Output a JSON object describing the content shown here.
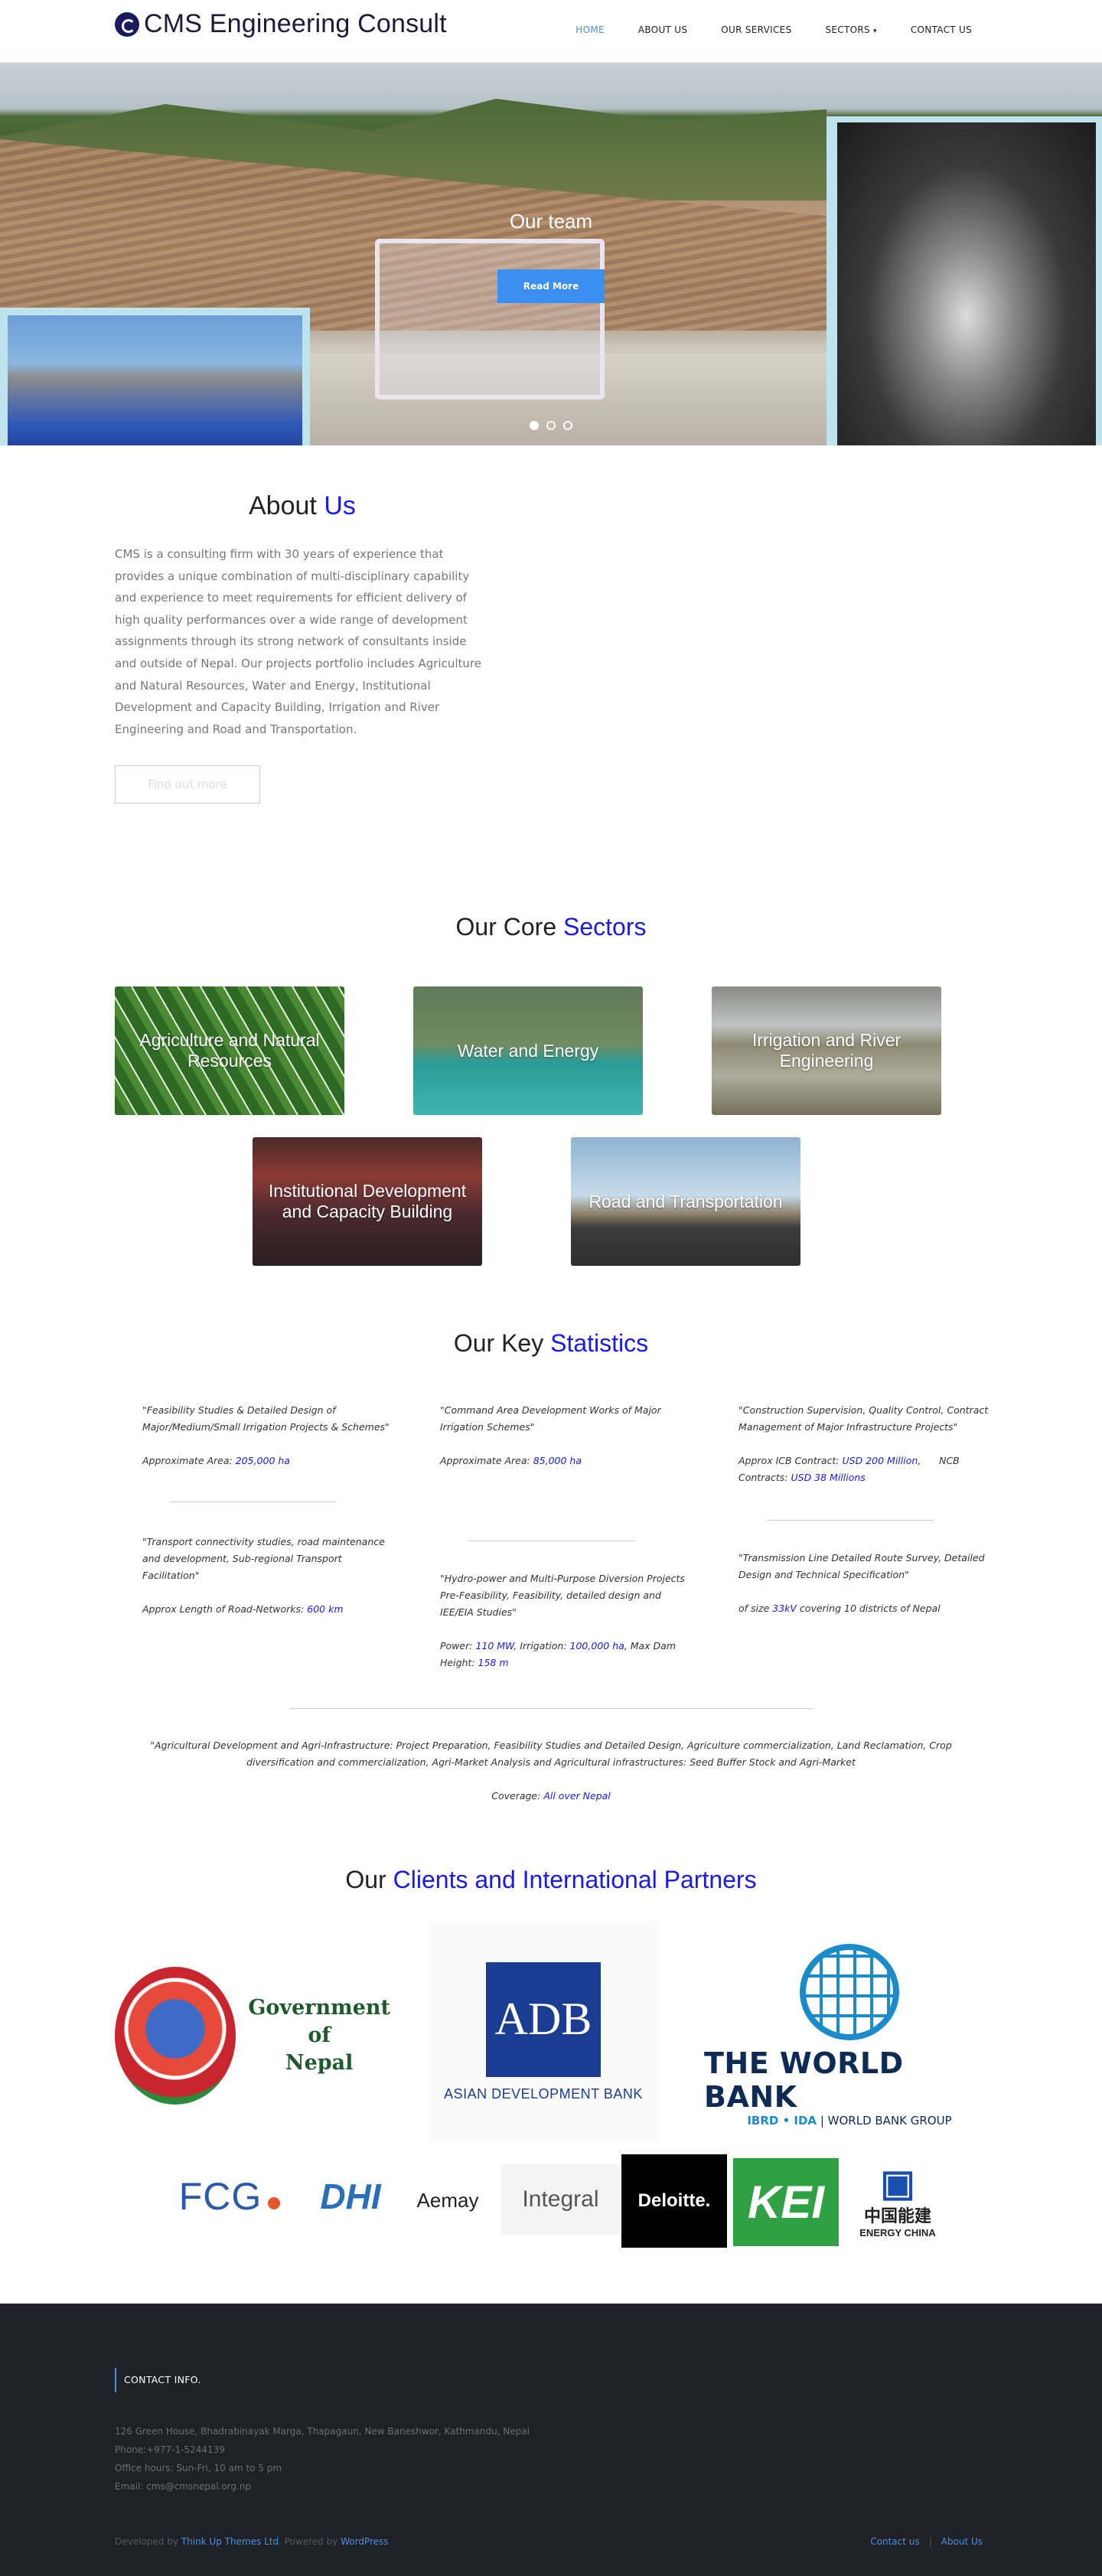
{
  "header": {
    "logo_text": "CMS Engineering Consult",
    "nav": [
      {
        "label": "HOME",
        "active": true
      },
      {
        "label": "ABOUT US"
      },
      {
        "label": "OUR SERVICES"
      },
      {
        "label": "SECTORS"
      },
      {
        "label": "CONTACT US"
      }
    ],
    "dropdown_caret": "▾"
  },
  "hero": {
    "caption": "Our team",
    "button_label": "Read More",
    "slides": 3,
    "active_slide": 1
  },
  "about": {
    "title_a": "About",
    "title_b": "Us",
    "body": "CMS is a consulting firm with 30 years of experience that provides a unique combination of multi-disciplinary capability and experience to meet requirements for efficient delivery of high quality performances over a wide range of development assignments through its strong network of consultants inside and outside of Nepal. Our projects portfolio includes Agriculture and Natural Resources, Water and Energy, Institutional Development and Capacity Building, Irrigation and River Engineering and Road and Transportation.",
    "button_label": "Find out more"
  },
  "sectors": {
    "title_a": "Our Core",
    "title_b": "Sectors",
    "items": [
      "Agriculture and Natural Resources",
      "Water and Energy",
      "Irrigation and River Engineering",
      "Institutional Development and Capacity Building",
      "Road and Transportation"
    ]
  },
  "stats": {
    "title_a": "Our Key",
    "title_b": "Statistics",
    "s1": {
      "quote": "\"Feasibility Studies & Detailed Design of Major/Medium/Small Irrigation Projects & Schemes\"",
      "label": "Approximate Area:",
      "value": "205,000 ha"
    },
    "s2": {
      "quote": "\"Command Area Development Works of Major Irrigation Schemes\"",
      "label": "Approximate Area:",
      "value": "85,000 ha"
    },
    "s3": {
      "quote": "\"Construction Supervision, Quality Control, Contract Management of Major Infrastructure Projects\"",
      "label1": "Approx ICB Contract:",
      "value1": "USD 200 Million,",
      "label2": "NCB",
      "label3": "Contracts:",
      "value2": "USD 38 Millions"
    },
    "s4": {
      "quote": "\"Transport connectivity studies, road maintenance and development, Sub-regional Transport Facilitation\"",
      "label": "Approx Length of Road-Networks:",
      "value": "600 km"
    },
    "s5": {
      "quote": "\"Hydro-power and Multi-Purpose Diversion Projects Pre-Feasibility, Feasibility, detailed design and IEE/EIA Studies\"",
      "l1": "Power:",
      "v1": "110 MW",
      "l2": ", Irrigation:",
      "v2": "100,000 ha",
      "l3": ", Max Dam",
      "l4": "Height:",
      "v3": "158 m"
    },
    "s6": {
      "quote": "\"Transmission Line Detailed Route Survey, Detailed Design and Technical Specification\"",
      "l1": "of size",
      "v1": "33kV",
      "l2": "covering 10 districts of Nepal"
    },
    "s7": {
      "quote": "\"Agricultural Development and Agri-Infrastructure: Project Preparation, Feasibility Studies and Detailed Design, Agriculture commercialization, Land Reclamation, Crop diversification and commercialization, Agri-Market Analysis and Agricultural infrastructures: Seed Buffer Stock and Agri-Market",
      "label": "Coverage:",
      "value": "All over Nepal"
    }
  },
  "partners": {
    "title_a": "Our",
    "title_b": "Clients and International Partners",
    "gov": {
      "line1": "Government",
      "line2": "of",
      "line3": "Nepal"
    },
    "adb": {
      "mark": "ADB",
      "name": "ASIAN DEVELOPMENT BANK"
    },
    "wb": {
      "name": "THE WORLD BANK",
      "sub_a": "IBRD • IDA",
      "sub_b": "| WORLD BANK GROUP"
    },
    "small": [
      "FCG",
      "DHI",
      "Aemay",
      "Integral",
      "Deloitte.",
      "KEI",
      "中国能建",
      "ENERGY CHINA"
    ]
  },
  "footer": {
    "heading": "CONTACT INFO.",
    "address": "126 Green House, Bhadrabinayak Marga, Thapagaun, New Baneshwor, Kathmandu, Nepal",
    "phone": "Phone:+977-1-5244139",
    "hours": "Office hours: Sun-Fri, 10 am to 5 pm",
    "email": "Email: cms@cmsnepal.org.np",
    "dev_prefix": "Developed by",
    "dev_link": "Think Up Themes Ltd",
    "powered_prefix": ". Powered by",
    "powered_link": "WordPress",
    "link_contact": "Contact us",
    "link_about": "About Us"
  }
}
